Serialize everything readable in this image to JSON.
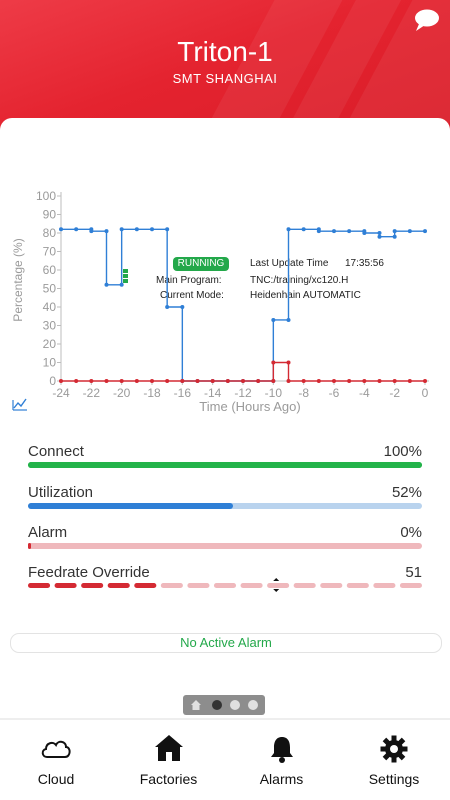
{
  "header": {
    "machine_name": "Triton-1",
    "location": "SMT SHANGHAI",
    "chat_icon": "chat-bubble-icon"
  },
  "status": {
    "state": "RUNNING",
    "state_color": "#23a84a",
    "last_update_label": "Last Update Time",
    "last_update_time": "17:35:56",
    "main_program_label": "Main Program:",
    "main_program_value": "TNC:/training/xc120.H",
    "current_mode_label": "Current Mode:",
    "current_mode_value": "Heidenhain AUTOMATIC"
  },
  "chart_data": {
    "type": "line",
    "xlabel": "Time (Hours Ago)",
    "ylabel": "Percentage (%)",
    "xlim": [
      -24,
      0
    ],
    "ylim": [
      0,
      100
    ],
    "x_ticks": [
      -24,
      -22,
      -20,
      -18,
      -16,
      -14,
      -12,
      -10,
      -8,
      -6,
      -4,
      -2,
      0
    ],
    "y_ticks": [
      0,
      10,
      20,
      30,
      40,
      50,
      60,
      70,
      80,
      90,
      100
    ],
    "grid": false,
    "series": [
      {
        "color": "#2f7fd6",
        "step": true,
        "x": [
          -24,
          -23,
          -22,
          -21,
          -20,
          -19,
          -18,
          -17,
          -16,
          -15,
          -14,
          -13,
          -12,
          -11,
          -10,
          -9,
          -8,
          -7,
          -6,
          -5,
          -4,
          -3,
          -2,
          -1,
          0
        ],
        "values": [
          82,
          82,
          81,
          52,
          82,
          82,
          82,
          40,
          0,
          0,
          0,
          0,
          0,
          0,
          33,
          82,
          82,
          81,
          81,
          81,
          80,
          78,
          81,
          81,
          81
        ]
      },
      {
        "color": "#d42a33",
        "step": true,
        "x": [
          -24,
          -23,
          -22,
          -21,
          -20,
          -19,
          -18,
          -17,
          -16,
          -15,
          -14,
          -13,
          -12,
          -11,
          -10,
          -9,
          -8,
          -7,
          -6,
          -5,
          -4,
          -3,
          -2,
          -1,
          0
        ],
        "values": [
          0,
          0,
          0,
          0,
          0,
          0,
          0,
          0,
          0,
          0,
          0,
          0,
          0,
          0,
          10,
          0,
          0,
          0,
          0,
          0,
          0,
          0,
          0,
          0,
          0
        ]
      }
    ],
    "chart_toggle_icon": "line-chart-icon"
  },
  "metrics": {
    "connect": {
      "label": "Connect",
      "value": "100%",
      "fraction": 1.0,
      "fill_color": "#23b34a",
      "track_color": "#23b34a"
    },
    "utilization": {
      "label": "Utilization",
      "value": "52%",
      "fraction": 0.52,
      "fill_color": "#2f7fd6",
      "track_color": "#b9d3ee"
    },
    "alarm": {
      "label": "Alarm",
      "value": "0%",
      "fraction": 0.0,
      "fill_color": "#d42a33",
      "track_color": "#efb8bc"
    },
    "feedrate": {
      "label": "Feedrate Override",
      "value": "51",
      "fraction": 0.34,
      "fill_color": "#d42a33",
      "track_color": "#efb8bc"
    }
  },
  "alarm_status": "No Active Alarm",
  "pager": {
    "active_index": 1,
    "count": 3
  },
  "nav": {
    "items": [
      {
        "label": "Cloud",
        "icon": "cloud-icon"
      },
      {
        "label": "Factories",
        "icon": "factory-home-icon"
      },
      {
        "label": "Alarms",
        "icon": "bell-icon"
      },
      {
        "label": "Settings",
        "icon": "gear-icon"
      }
    ]
  }
}
